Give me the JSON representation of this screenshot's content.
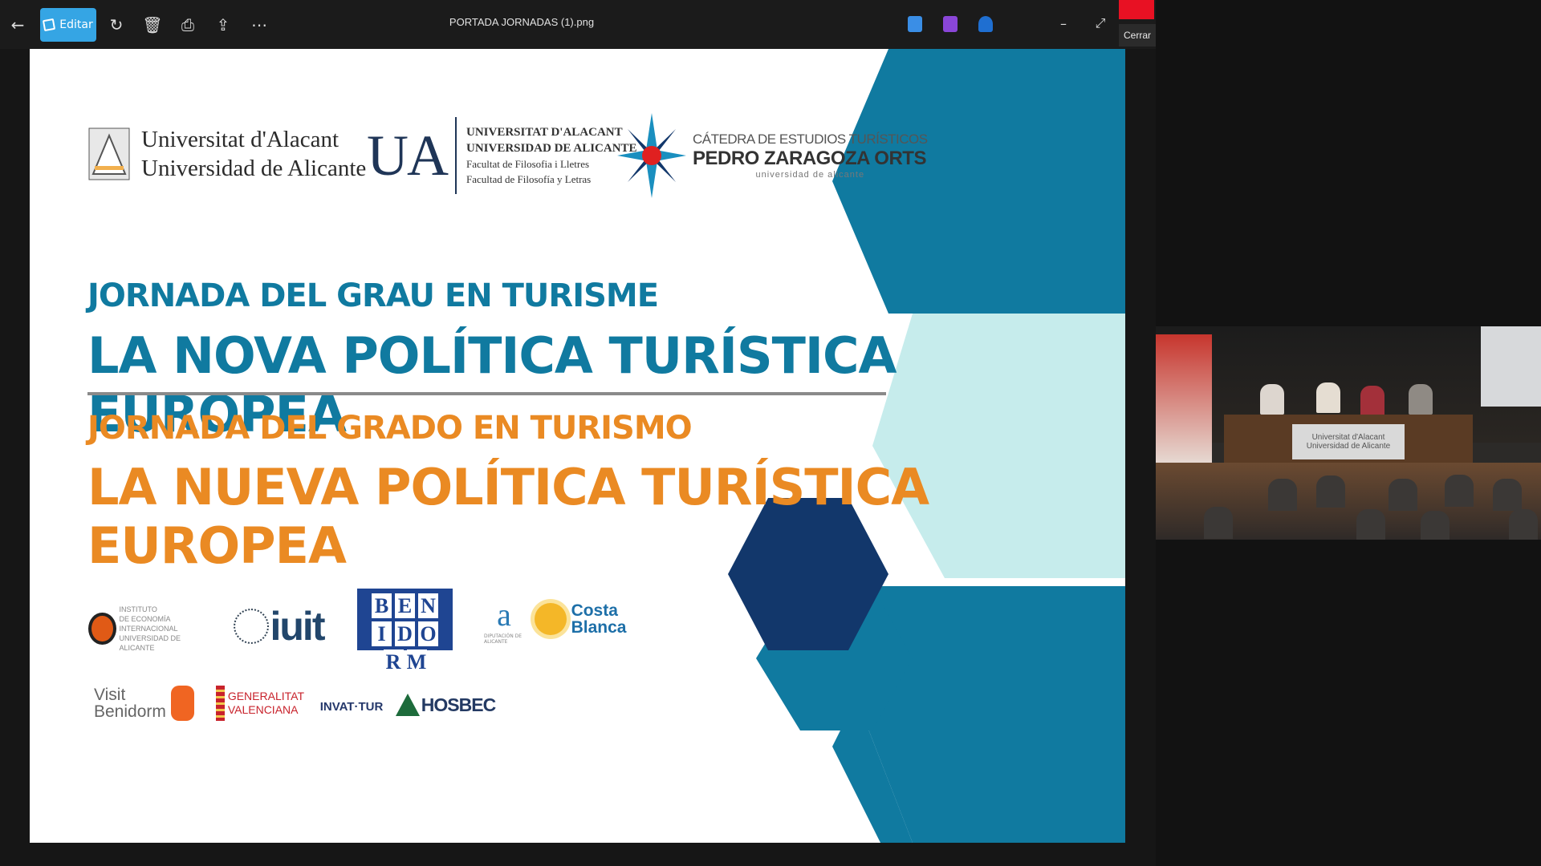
{
  "toolbar": {
    "edit_label": "Editar",
    "file_title": "PORTADA JORNADAS (1).png",
    "close_tooltip": "Cerrar"
  },
  "icons": [
    "back-arrow-icon",
    "rotate-icon",
    "trash-icon",
    "print-icon",
    "share-icon",
    "more-icon",
    "app-icon-1",
    "app-icon-2",
    "app-icon-3",
    "minimize-icon",
    "expand-icon",
    "close-icon"
  ],
  "slide": {
    "logos": {
      "ua_text": [
        "Universitat d'Alacant",
        "Universidad de Alicante"
      ],
      "ua_big": "UA",
      "ua_fac": [
        "UNIVERSITAT D'ALACANT",
        "UNIVERSIDAD DE ALICANTE",
        "Facultat de Filosofia i Lletres",
        "Facultad de Filosofía y Letras"
      ],
      "catedra": [
        "CÁTEDRA DE ESTUDIOS TURÍSTICOS",
        "PEDRO ZARAGOZA ORTS",
        "universidad de alicante"
      ]
    },
    "titles": {
      "cat_sub": "JORNADA DEL GRAU EN TURISME",
      "cat_title": "LA NOVA POLÍTICA TURÍSTICA EUROPEA",
      "es_sub": "JORNADA DEL GRADO EN TURISMO",
      "es_title": "LA NUEVA POLÍTICA TURÍSTICA EUROPEA"
    },
    "sponsors": {
      "iei": [
        "INSTITUTO",
        "DE ECONOMÍA",
        "INTERNACIONAL",
        "UNIVERSIDAD DE ALICANTE"
      ],
      "iuit": "iuit",
      "benidorm": [
        "B",
        "E",
        "N",
        "I",
        "D",
        "O",
        "R",
        "M"
      ],
      "alicante": [
        "a",
        "DIPUTACIÓN DE ALICANTE"
      ],
      "costa_blanca": [
        "Costa",
        "Blanca"
      ],
      "visit_benidorm": [
        "Visit",
        "Benidorm"
      ],
      "gva": [
        "GENERALITAT",
        "VALENCIANA"
      ],
      "invat": "INVAT·TUR",
      "hosbec": "HOSBEC"
    },
    "colors": {
      "teal": "#107aa0",
      "orange": "#ea8a23",
      "navy": "#12376b",
      "light_teal": "#c6ecec"
    }
  },
  "video": {
    "sign_text": [
      "Universitat d'Alacant",
      "Universidad de Alicante"
    ]
  }
}
